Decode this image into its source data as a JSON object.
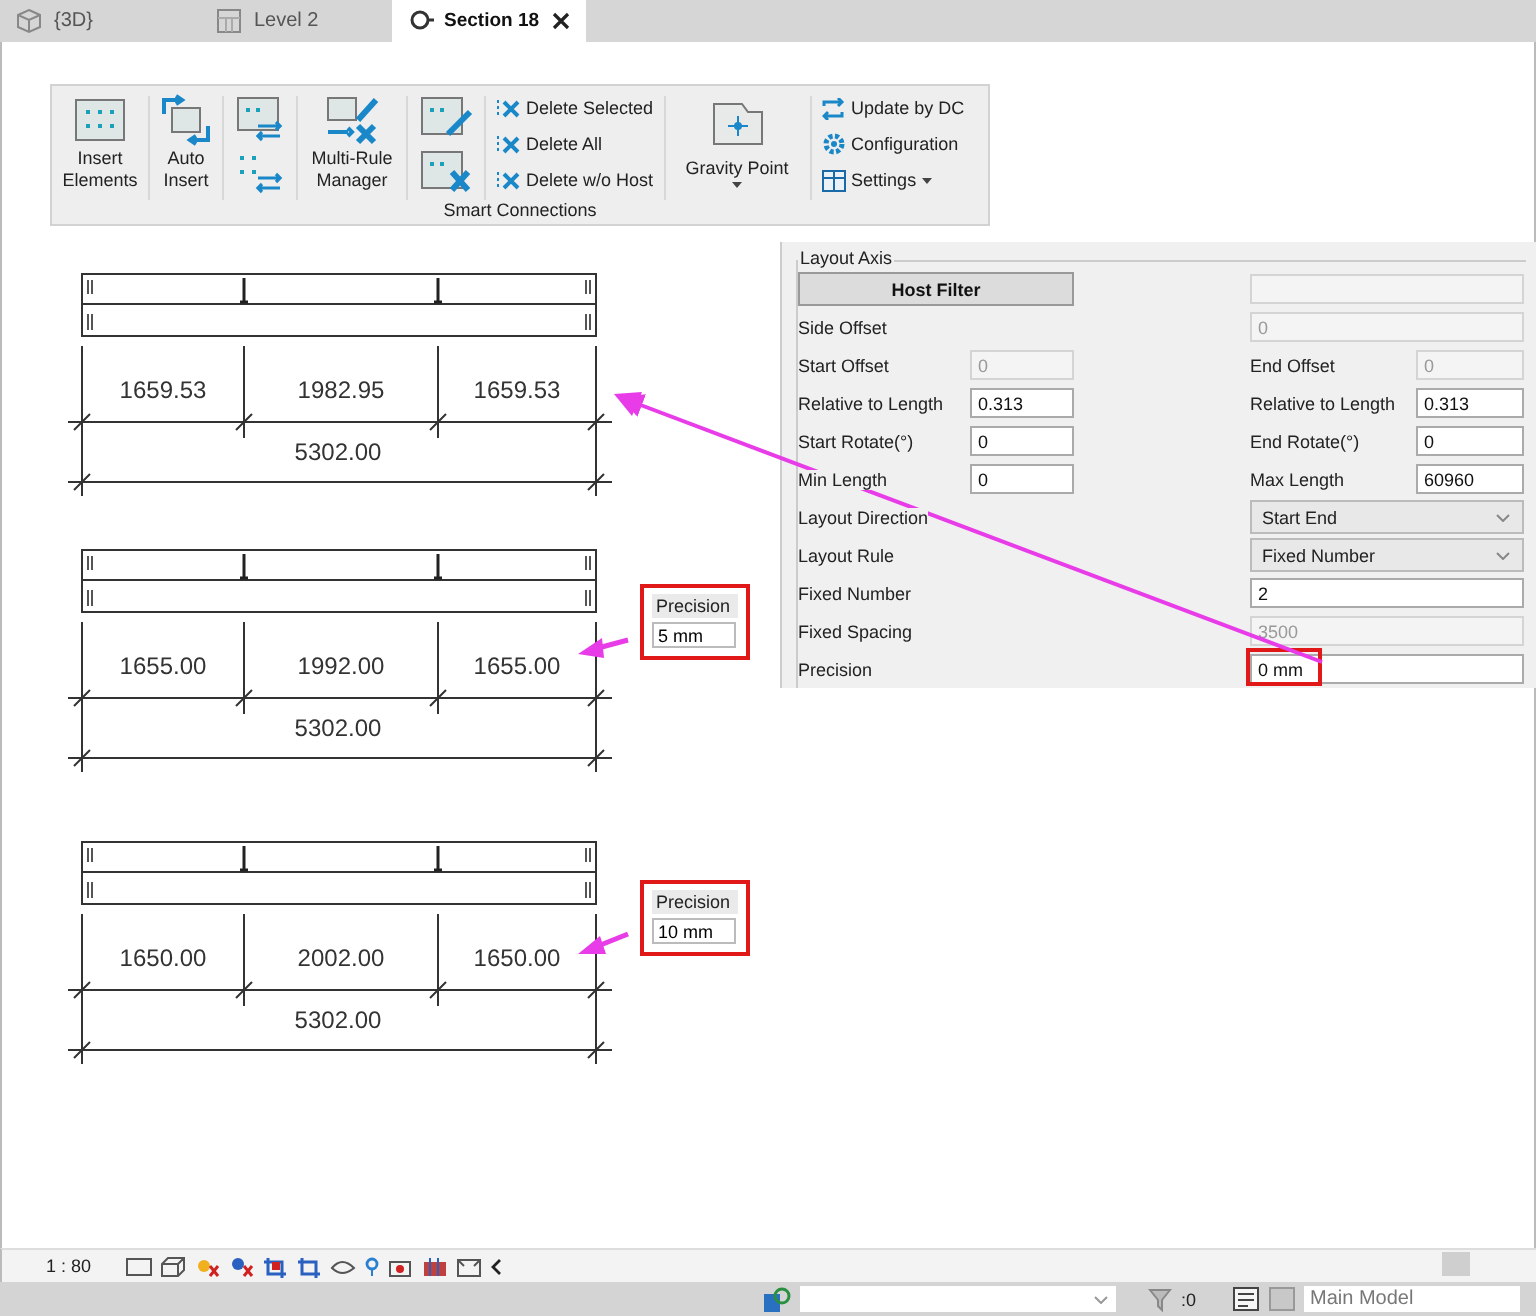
{
  "tabs": [
    {
      "label": "{3D}",
      "selected": false,
      "kind": "model"
    },
    {
      "label": "Level 2",
      "selected": false,
      "kind": "plan"
    },
    {
      "label": "Section 18",
      "selected": true,
      "kind": "section"
    }
  ],
  "ribbon": {
    "title": "Smart Connections",
    "groups": [
      {
        "kind": "large",
        "label": "Insert Elements"
      },
      {
        "kind": "large",
        "label": "Auto Insert"
      },
      {
        "kind": "icon-stack"
      },
      {
        "kind": "large",
        "label": "Multi-Rule Manager"
      },
      {
        "kind": "icon-stack"
      },
      {
        "kind": "small-list",
        "items": [
          {
            "label": "Delete Selected",
            "dropdown": false
          },
          {
            "label": "Delete All",
            "dropdown": false
          },
          {
            "label": "Delete w/o Host",
            "dropdown": false
          }
        ]
      },
      {
        "kind": "large-dropdown",
        "label": "Gravity Point"
      },
      {
        "kind": "small-list",
        "items": [
          {
            "label": "Update by DC",
            "dropdown": false
          },
          {
            "label": "Configuration",
            "dropdown": false
          },
          {
            "label": "Settings",
            "dropdown": true
          }
        ]
      }
    ]
  },
  "sections": [
    {
      "segments": [
        "1659.53",
        "1982.95",
        "1659.53"
      ],
      "total": "5302.00"
    },
    {
      "segments": [
        "1655.00",
        "1992.00",
        "1655.00"
      ],
      "total": "5302.00"
    },
    {
      "segments": [
        "1650.00",
        "2002.00",
        "1650.00"
      ],
      "total": "5302.00"
    }
  ],
  "callouts": [
    {
      "label": "Precision",
      "value": "5 mm"
    },
    {
      "label": "Precision",
      "value": "10 mm"
    }
  ],
  "properties": {
    "title": "Layout Axis",
    "rows": [
      {
        "kind": "button",
        "label": "Host Filter",
        "field": {
          "disabled": true
        }
      },
      {
        "kind": "wide",
        "label": "Side Offset",
        "field": {
          "value": "0",
          "disabled": true
        }
      },
      {
        "kind": "pair",
        "left": {
          "label": "Start Offset",
          "value": "0",
          "disabled": true
        },
        "right": {
          "label": "End Offset",
          "value": "0",
          "disabled": true
        }
      },
      {
        "kind": "pair",
        "left": {
          "label": "Relative to Length",
          "value": "0.313",
          "disabled": false
        },
        "right": {
          "label": "Relative to Length",
          "value": "0.313",
          "disabled": false
        }
      },
      {
        "kind": "pair",
        "left": {
          "label": "Start Rotate(°)",
          "value": "0",
          "disabled": false
        },
        "right": {
          "label": "End Rotate(°)",
          "value": "0",
          "disabled": false
        }
      },
      {
        "kind": "pair",
        "left": {
          "label": "Min Length",
          "value": "0",
          "disabled": false
        },
        "right": {
          "label": "Max Length",
          "value": "60960",
          "disabled": false
        }
      },
      {
        "kind": "select",
        "label": "Layout Direction",
        "value": "Start End"
      },
      {
        "kind": "select",
        "label": "Layout Rule",
        "value": "Fixed Number"
      },
      {
        "kind": "wide",
        "label": "Fixed Number",
        "field": {
          "value": "2",
          "disabled": false
        }
      },
      {
        "kind": "wide",
        "label": "Fixed Spacing",
        "field": {
          "value": "3500",
          "disabled": true
        }
      },
      {
        "kind": "wide",
        "label": "Precision",
        "field": {
          "value": "0 mm",
          "disabled": false
        },
        "highlighted": true
      }
    ]
  },
  "view_bar": {
    "scale": "1 : 80"
  },
  "status_bar": {
    "count": ":0",
    "model": "Main Model"
  }
}
